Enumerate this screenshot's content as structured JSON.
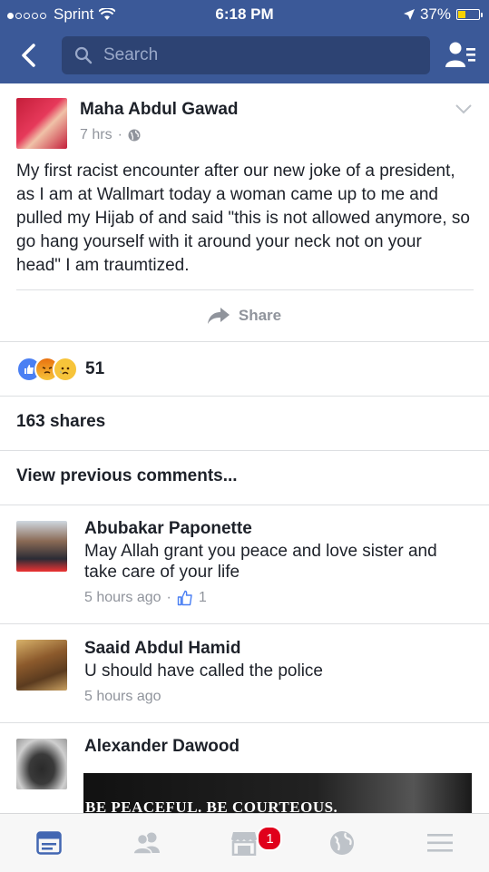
{
  "status": {
    "carrier": "Sprint",
    "time": "6:18 PM",
    "battery": "37%",
    "battery_level": 0.37
  },
  "nav": {
    "search_placeholder": "Search"
  },
  "post": {
    "author": "Maha Abdul Gawad",
    "time": "7 hrs",
    "text": "My first racist encounter after our new joke of a president, as I am at Wallmart today a woman came up to me and pulled my Hijab of and said \"this is not allowed anymore, so go hang yourself with it around your neck not on your head\" I am traumtized.",
    "share_label": "Share",
    "reaction_count": "51",
    "shares": "163 shares",
    "view_previous": "View previous comments..."
  },
  "comments": [
    {
      "name": "Abubakar Paponette",
      "text": "May Allah grant you peace and love sister and take care of your life",
      "time": "5 hours ago",
      "likes": "1"
    },
    {
      "name": "Saaid Abdul Hamid",
      "text": "U should have called the police",
      "time": "5 hours ago"
    },
    {
      "name": "Alexander Dawood",
      "image_text": "BE PEACEFUL. BE COURTEOUS."
    }
  ],
  "tabbar": {
    "marketplace_badge": "1"
  },
  "colors": {
    "brand": "#3b5998",
    "search_bg": "#2d4373",
    "badge": "#e0001b",
    "active_tab": "#4267b2",
    "inactive_tab": "#bec3c9"
  }
}
